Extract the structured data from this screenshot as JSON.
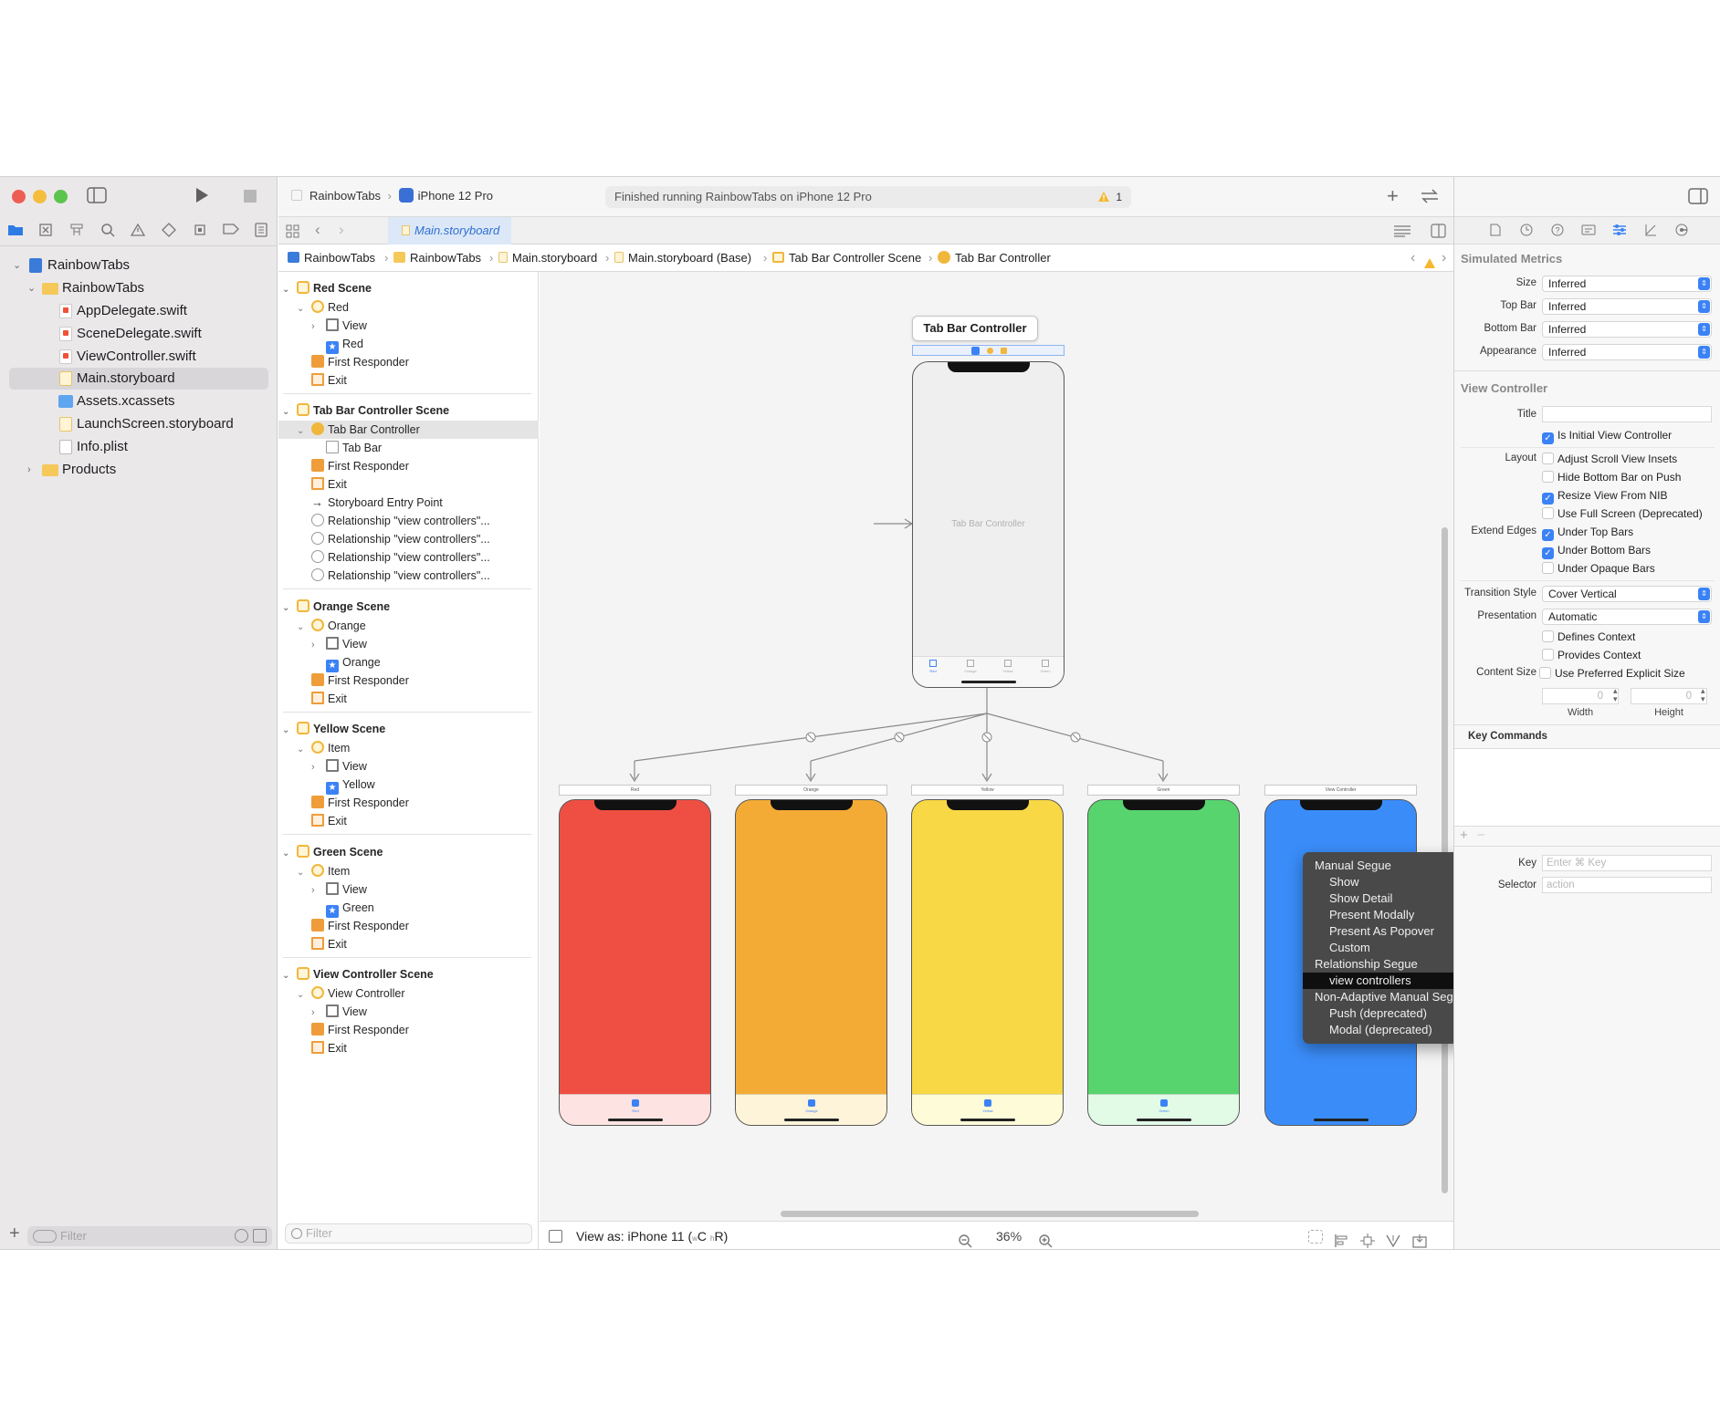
{
  "colors": {
    "accent": "#3b82f6",
    "traffic_red": "#ee5d54",
    "traffic_yellow": "#f5bd3d",
    "traffic_green": "#5ac44d",
    "red_scene": "#ef4f43",
    "orange_scene": "#f3ab36",
    "yellow_scene": "#f9d846",
    "green_scene": "#58d46e",
    "blue_scene": "#3a8cf8"
  },
  "toolbar": {
    "scheme": "RainbowTabs",
    "device": "iPhone 12 Pro",
    "status": "Finished running RainbowTabs on iPhone 12 Pro",
    "warning_count": "1",
    "add_icon": "plus-icon",
    "swap_icon": "swap-icon"
  },
  "tab": {
    "label": "Main.storyboard"
  },
  "breadcrumbs": [
    "RainbowTabs",
    "RainbowTabs",
    "Main.storyboard",
    "Main.storyboard (Base)",
    "Tab Bar Controller Scene",
    "Tab Bar Controller"
  ],
  "navigator": {
    "project": "RainbowTabs",
    "group": "RainbowTabs",
    "files": [
      "AppDelegate.swift",
      "SceneDelegate.swift",
      "ViewController.swift",
      "Main.storyboard",
      "Assets.xcassets",
      "LaunchScreen.storyboard",
      "Info.plist"
    ],
    "products": "Products",
    "filter_placeholder": "Filter"
  },
  "outline": {
    "filter_placeholder": "Filter",
    "scenes": [
      {
        "title": "Red Scene",
        "items": [
          "Red",
          "View",
          "Red",
          "First Responder",
          "Exit"
        ]
      },
      {
        "title": "Tab Bar Controller Scene",
        "items": [
          "Tab Bar Controller",
          "Tab Bar",
          "First Responder",
          "Exit",
          "Storyboard Entry Point",
          "Relationship \"view controllers\"...",
          "Relationship \"view controllers\"...",
          "Relationship \"view controllers\"...",
          "Relationship \"view controllers\"..."
        ]
      },
      {
        "title": "Orange Scene",
        "items": [
          "Orange",
          "View",
          "Orange",
          "First Responder",
          "Exit"
        ]
      },
      {
        "title": "Yellow Scene",
        "items": [
          "Item",
          "View",
          "Yellow",
          "First Responder",
          "Exit"
        ]
      },
      {
        "title": "Green Scene",
        "items": [
          "Item",
          "View",
          "Green",
          "First Responder",
          "Exit"
        ]
      },
      {
        "title": "View Controller Scene",
        "items": [
          "View Controller",
          "View",
          "First Responder",
          "Exit"
        ]
      }
    ]
  },
  "canvas": {
    "tbc_title": "Tab Bar Controller",
    "tbc_body_label": "Tab Bar Controller",
    "phones": [
      {
        "title": "Red",
        "tab_label": "Red"
      },
      {
        "title": "Orange",
        "tab_label": "Orange"
      },
      {
        "title": "Yellow",
        "tab_label": "Yellow"
      },
      {
        "title": "Green",
        "tab_label": "Green"
      },
      {
        "title": "View Controller",
        "tab_label": ""
      }
    ],
    "tbc_tabs": [
      "Red",
      "Orange",
      "Yellow",
      "Green"
    ],
    "view_as": "View as: iPhone 11 (",
    "size_class_w": "w",
    "size_class_c": "C",
    "size_class_h": "h",
    "size_class_r": "R)",
    "zoom": "36%"
  },
  "segue_menu": {
    "items": [
      {
        "label": "Manual Segue",
        "kind": "header"
      },
      {
        "label": "Show",
        "kind": "sub"
      },
      {
        "label": "Show Detail",
        "kind": "sub"
      },
      {
        "label": "Present Modally",
        "kind": "sub"
      },
      {
        "label": "Present As Popover",
        "kind": "sub"
      },
      {
        "label": "Custom",
        "kind": "sub"
      },
      {
        "label": "Relationship Segue",
        "kind": "header"
      },
      {
        "label": "view controllers",
        "kind": "sub-active"
      },
      {
        "label": "Non-Adaptive Manual Segue",
        "kind": "header"
      },
      {
        "label": "Push (deprecated)",
        "kind": "sub"
      },
      {
        "label": "Modal (deprecated)",
        "kind": "sub"
      }
    ]
  },
  "inspector": {
    "simulated_metrics": "Simulated Metrics",
    "size_label": "Size",
    "size_value": "Inferred",
    "top_bar_label": "Top Bar",
    "top_bar_value": "Inferred",
    "bottom_bar_label": "Bottom Bar",
    "bottom_bar_value": "Inferred",
    "appearance_label": "Appearance",
    "appearance_value": "Inferred",
    "view_controller": "View Controller",
    "title_label": "Title",
    "is_initial": "Is Initial View Controller",
    "layout_label": "Layout",
    "adjust_scroll": "Adjust Scroll View Insets",
    "hide_bottom": "Hide Bottom Bar on Push",
    "resize_nib": "Resize View From NIB",
    "full_screen": "Use Full Screen (Deprecated)",
    "extend_edges_label": "Extend Edges",
    "under_top": "Under Top Bars",
    "under_bottom": "Under Bottom Bars",
    "under_opaque": "Under Opaque Bars",
    "transition_label": "Transition Style",
    "transition_value": "Cover Vertical",
    "presentation_label": "Presentation",
    "presentation_value": "Automatic",
    "defines_context": "Defines Context",
    "provides_context": "Provides Context",
    "content_size_label": "Content Size",
    "use_preferred": "Use Preferred Explicit Size",
    "width_value": "0",
    "height_value": "0",
    "width_label": "Width",
    "height_label": "Height",
    "key_commands": "Key Commands",
    "key_label": "Key",
    "key_placeholder": "Enter ⌘ Key",
    "selector_label": "Selector",
    "selector_placeholder": "action"
  }
}
